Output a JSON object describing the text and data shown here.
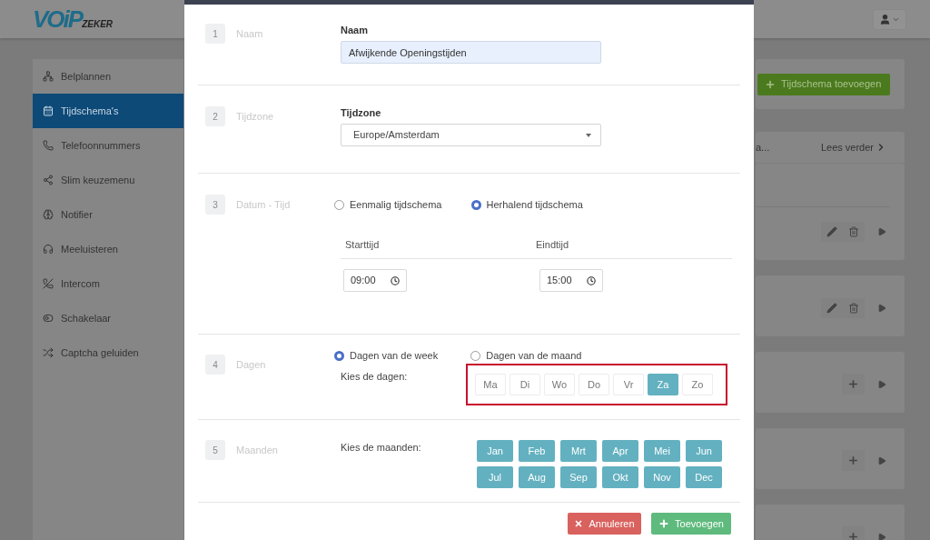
{
  "header": {
    "logo": {
      "main": "VOiP",
      "sub": "ZEKER"
    }
  },
  "sidebar": {
    "items": [
      {
        "label": "Belplannen",
        "selected": false
      },
      {
        "label": "Tijdschema's",
        "selected": true
      },
      {
        "label": "Telefoonnummers",
        "selected": false
      },
      {
        "label": "Slim keuzemenu",
        "selected": false
      },
      {
        "label": "Notifier",
        "selected": false
      },
      {
        "label": "Meeluisteren",
        "selected": false
      },
      {
        "label": "Intercom",
        "selected": false
      },
      {
        "label": "Schakelaar",
        "selected": false
      },
      {
        "label": "Captcha geluiden",
        "selected": false
      }
    ]
  },
  "page": {
    "add_button": "Tijdschema toevoegen",
    "list_header": {
      "text": "a...",
      "link": "Lees verder"
    },
    "rows": [
      {
        "kind": "edit"
      },
      {
        "kind": "edit"
      },
      {
        "kind": "add"
      },
      {
        "kind": "add"
      },
      {
        "kind": "add"
      }
    ]
  },
  "modal": {
    "name_step": {
      "number": "1",
      "label": "Naam",
      "field_label": "Naam",
      "value": "Afwijkende Openingstijden"
    },
    "timezone_step": {
      "number": "2",
      "label": "Tijdzone",
      "field_label": "Tijdzone",
      "value": "Europe/Amsterdam"
    },
    "datetime_step": {
      "number": "3",
      "label": "Datum - Tijd",
      "radios": [
        {
          "label": "Eenmalig tijdschema",
          "selected": false
        },
        {
          "label": "Herhalend tijdschema",
          "selected": true
        }
      ],
      "start_label": "Starttijd",
      "end_label": "Eindtijd",
      "start_time": "09:00",
      "end_time": "15:00"
    },
    "days_step": {
      "number": "4",
      "label": "Dagen",
      "radios": [
        {
          "label": "Dagen van de week",
          "selected": true
        },
        {
          "label": "Dagen van de maand",
          "selected": false
        }
      ],
      "prompt": "Kies de dagen:",
      "days": [
        {
          "label": "Ma",
          "selected": false
        },
        {
          "label": "Di",
          "selected": false
        },
        {
          "label": "Wo",
          "selected": false
        },
        {
          "label": "Do",
          "selected": false
        },
        {
          "label": "Vr",
          "selected": false
        },
        {
          "label": "Za",
          "selected": true
        },
        {
          "label": "Zo",
          "selected": false
        }
      ]
    },
    "months_step": {
      "number": "5",
      "label": "Maanden",
      "prompt": "Kies de maanden:",
      "months": [
        {
          "label": "Jan",
          "selected": true
        },
        {
          "label": "Feb",
          "selected": true
        },
        {
          "label": "Mrt",
          "selected": true
        },
        {
          "label": "Apr",
          "selected": true
        },
        {
          "label": "Mei",
          "selected": true
        },
        {
          "label": "Jun",
          "selected": true
        },
        {
          "label": "Jul",
          "selected": true
        },
        {
          "label": "Aug",
          "selected": true
        },
        {
          "label": "Sep",
          "selected": true
        },
        {
          "label": "Okt",
          "selected": true
        },
        {
          "label": "Nov",
          "selected": true
        },
        {
          "label": "Dec",
          "selected": true
        }
      ]
    },
    "cancel_button": "Annuleren",
    "submit_button": "Toevoegen"
  }
}
